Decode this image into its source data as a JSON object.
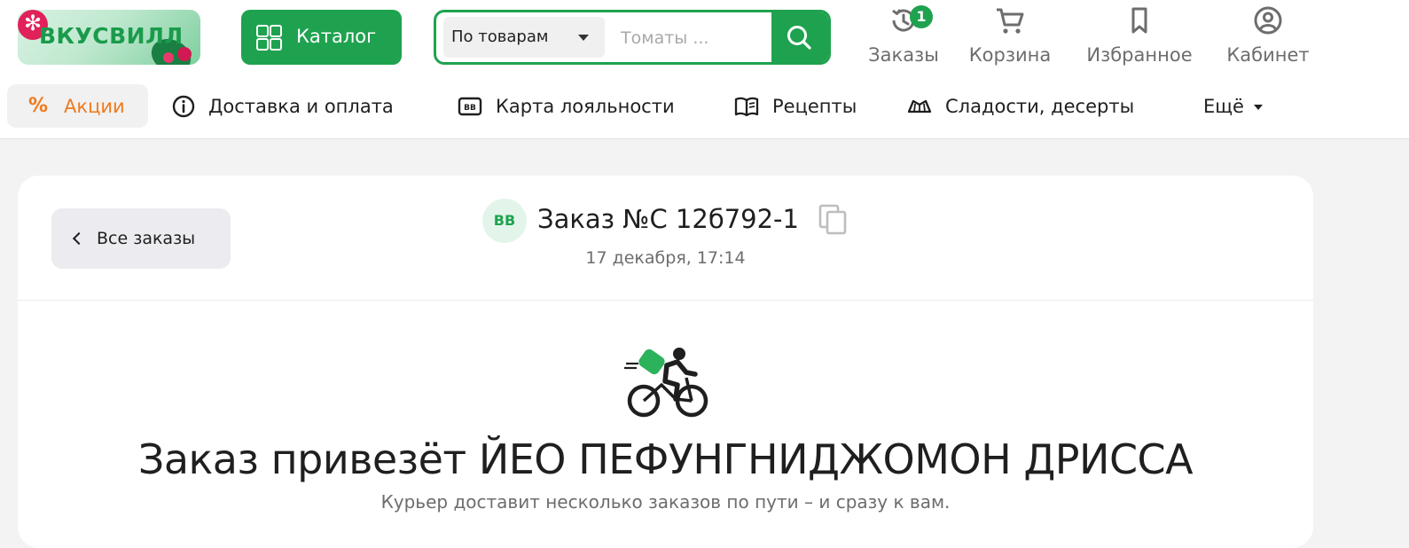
{
  "header": {
    "logo_text": "ВКУСВИЛЛ",
    "catalog_label": "Каталог",
    "search": {
      "scope_label": "По товарам",
      "placeholder": "Томаты ..."
    },
    "icons": {
      "orders": {
        "label": "Заказы",
        "badge": "1"
      },
      "cart": {
        "label": "Корзина"
      },
      "favorites": {
        "label": "Избранное"
      },
      "cabinet": {
        "label": "Кабинет"
      }
    }
  },
  "nav": {
    "items": [
      {
        "label": "Акции",
        "icon": "percent-icon"
      },
      {
        "label": "Доставка и оплата",
        "icon": "info-icon"
      },
      {
        "label": "Карта лояльности",
        "icon": "card-icon"
      },
      {
        "label": "Рецепты",
        "icon": "book-icon"
      },
      {
        "label": "Сладости, десерты",
        "icon": "cake-icon"
      },
      {
        "label": "Ещё",
        "icon": "caret-down-icon"
      }
    ]
  },
  "order": {
    "back_label": "Все заказы",
    "badge": "ВВ",
    "title": "Заказ №С    12б792-1",
    "date": "17 декабря, 17:14",
    "headline": "Заказ привезёт ЙЕО ПЕФУНГНИДЖОМОН ДРИССА",
    "subline": "Курьер доставит несколько заказов по пути – и сразу к вам."
  },
  "colors": {
    "brand_green": "#1fa24f",
    "promo_orange": "#f07a1c",
    "text_dark": "#1f1f1f",
    "text_muted": "#6d6d6d"
  }
}
